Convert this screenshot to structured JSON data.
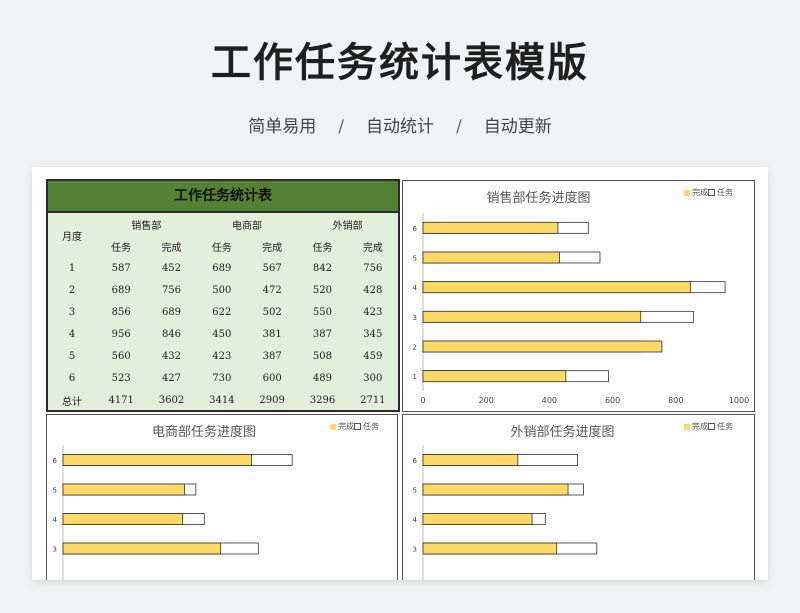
{
  "page": {
    "title": "工作任务统计表模版",
    "subtitle": [
      "简单易用",
      "自动统计",
      "自动更新"
    ],
    "separator": "/"
  },
  "table": {
    "title": "工作任务统计表",
    "month_label": "月度",
    "departments": [
      "销售部",
      "电商部",
      "外销部"
    ],
    "sub_headers": [
      "任务",
      "完成"
    ],
    "rows": [
      {
        "month": "1",
        "values": [
          "587",
          "452",
          "689",
          "567",
          "842",
          "756"
        ]
      },
      {
        "month": "2",
        "values": [
          "689",
          "756",
          "500",
          "472",
          "520",
          "428"
        ]
      },
      {
        "month": "3",
        "values": [
          "856",
          "689",
          "622",
          "502",
          "550",
          "423"
        ]
      },
      {
        "month": "4",
        "values": [
          "956",
          "846",
          "450",
          "381",
          "387",
          "345"
        ]
      },
      {
        "month": "5",
        "values": [
          "560",
          "432",
          "423",
          "387",
          "508",
          "459"
        ]
      },
      {
        "month": "6",
        "values": [
          "523",
          "427",
          "730",
          "600",
          "489",
          "300"
        ]
      }
    ],
    "total": {
      "label": "总计",
      "values": [
        "4171",
        "3602",
        "3414",
        "2909",
        "3296",
        "2711"
      ]
    }
  },
  "legend": {
    "done": "完成",
    "task": "任务"
  },
  "colors": {
    "done": "#ffd966",
    "task": "#ffffff",
    "header": "#548235",
    "table_bg": "#e2efda"
  },
  "chart_data": [
    {
      "type": "bar",
      "orientation": "horizontal",
      "title": "销售部任务进度图",
      "categories": [
        "1",
        "2",
        "3",
        "4",
        "5",
        "6"
      ],
      "series": [
        {
          "name": "完成",
          "values": [
            452,
            756,
            689,
            846,
            432,
            427
          ]
        },
        {
          "name": "任务",
          "values": [
            587,
            689,
            856,
            956,
            560,
            523
          ]
        }
      ],
      "xlim": [
        0,
        1000
      ],
      "xticks": [
        "0",
        "200",
        "400",
        "600",
        "800",
        "1000"
      ],
      "legend_position": "top-right"
    },
    {
      "type": "bar",
      "orientation": "horizontal",
      "title": "电商部任务进度图",
      "categories": [
        "3",
        "4",
        "5",
        "6"
      ],
      "series": [
        {
          "name": "完成",
          "values": [
            502,
            381,
            387,
            600
          ]
        },
        {
          "name": "任务",
          "values": [
            622,
            450,
            423,
            730
          ]
        }
      ],
      "xlim": [
        0,
        1000
      ],
      "legend_position": "top-right"
    },
    {
      "type": "bar",
      "orientation": "horizontal",
      "title": "外销部任务进度图",
      "categories": [
        "3",
        "4",
        "5",
        "6"
      ],
      "series": [
        {
          "name": "完成",
          "values": [
            423,
            345,
            459,
            300
          ]
        },
        {
          "name": "任务",
          "values": [
            550,
            387,
            508,
            489
          ]
        }
      ],
      "xlim": [
        0,
        1000
      ],
      "legend_position": "top-right"
    }
  ]
}
